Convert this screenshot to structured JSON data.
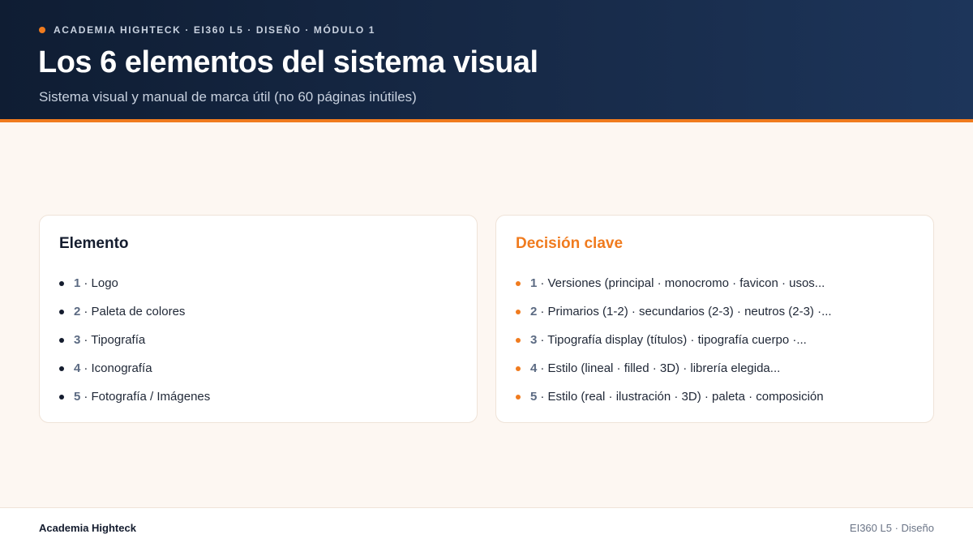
{
  "header": {
    "eyebrow": "ACADEMIA HIGHTECK · EI360 L5 · DISEÑO · MÓDULO 1",
    "title": "Los 6 elementos del sistema visual",
    "subtitle": "Sistema visual y manual de marca útil (no 60 páginas inútiles)"
  },
  "cards": {
    "left": {
      "heading": "Elemento",
      "items": [
        {
          "num": "1",
          "text": "· Logo"
        },
        {
          "num": "2",
          "text": "· Paleta de colores"
        },
        {
          "num": "3",
          "text": "· Tipografía"
        },
        {
          "num": "4",
          "text": "· Iconografía"
        },
        {
          "num": "5",
          "text": "· Fotografía / Imágenes"
        }
      ]
    },
    "right": {
      "heading": "Decisión clave",
      "items": [
        {
          "num": "1",
          "text": "· Versiones (principal · monocromo · favicon · usos..."
        },
        {
          "num": "2",
          "text": "· Primarios (1-2) · secundarios (2-3) · neutros (2-3) ·..."
        },
        {
          "num": "3",
          "text": "· Tipografía display (títulos) · tipografía cuerpo ·..."
        },
        {
          "num": "4",
          "text": "· Estilo (lineal · filled · 3D) · librería elegida..."
        },
        {
          "num": "5",
          "text": "· Estilo (real · ilustración · 3D) · paleta · composición"
        }
      ]
    }
  },
  "footer": {
    "brand": "Academia Highteck",
    "course": "EI360 L5 · Diseño"
  },
  "colors": {
    "accent": "#f07b1e",
    "navy": "#0f1d33",
    "background": "#fdf7f2"
  }
}
